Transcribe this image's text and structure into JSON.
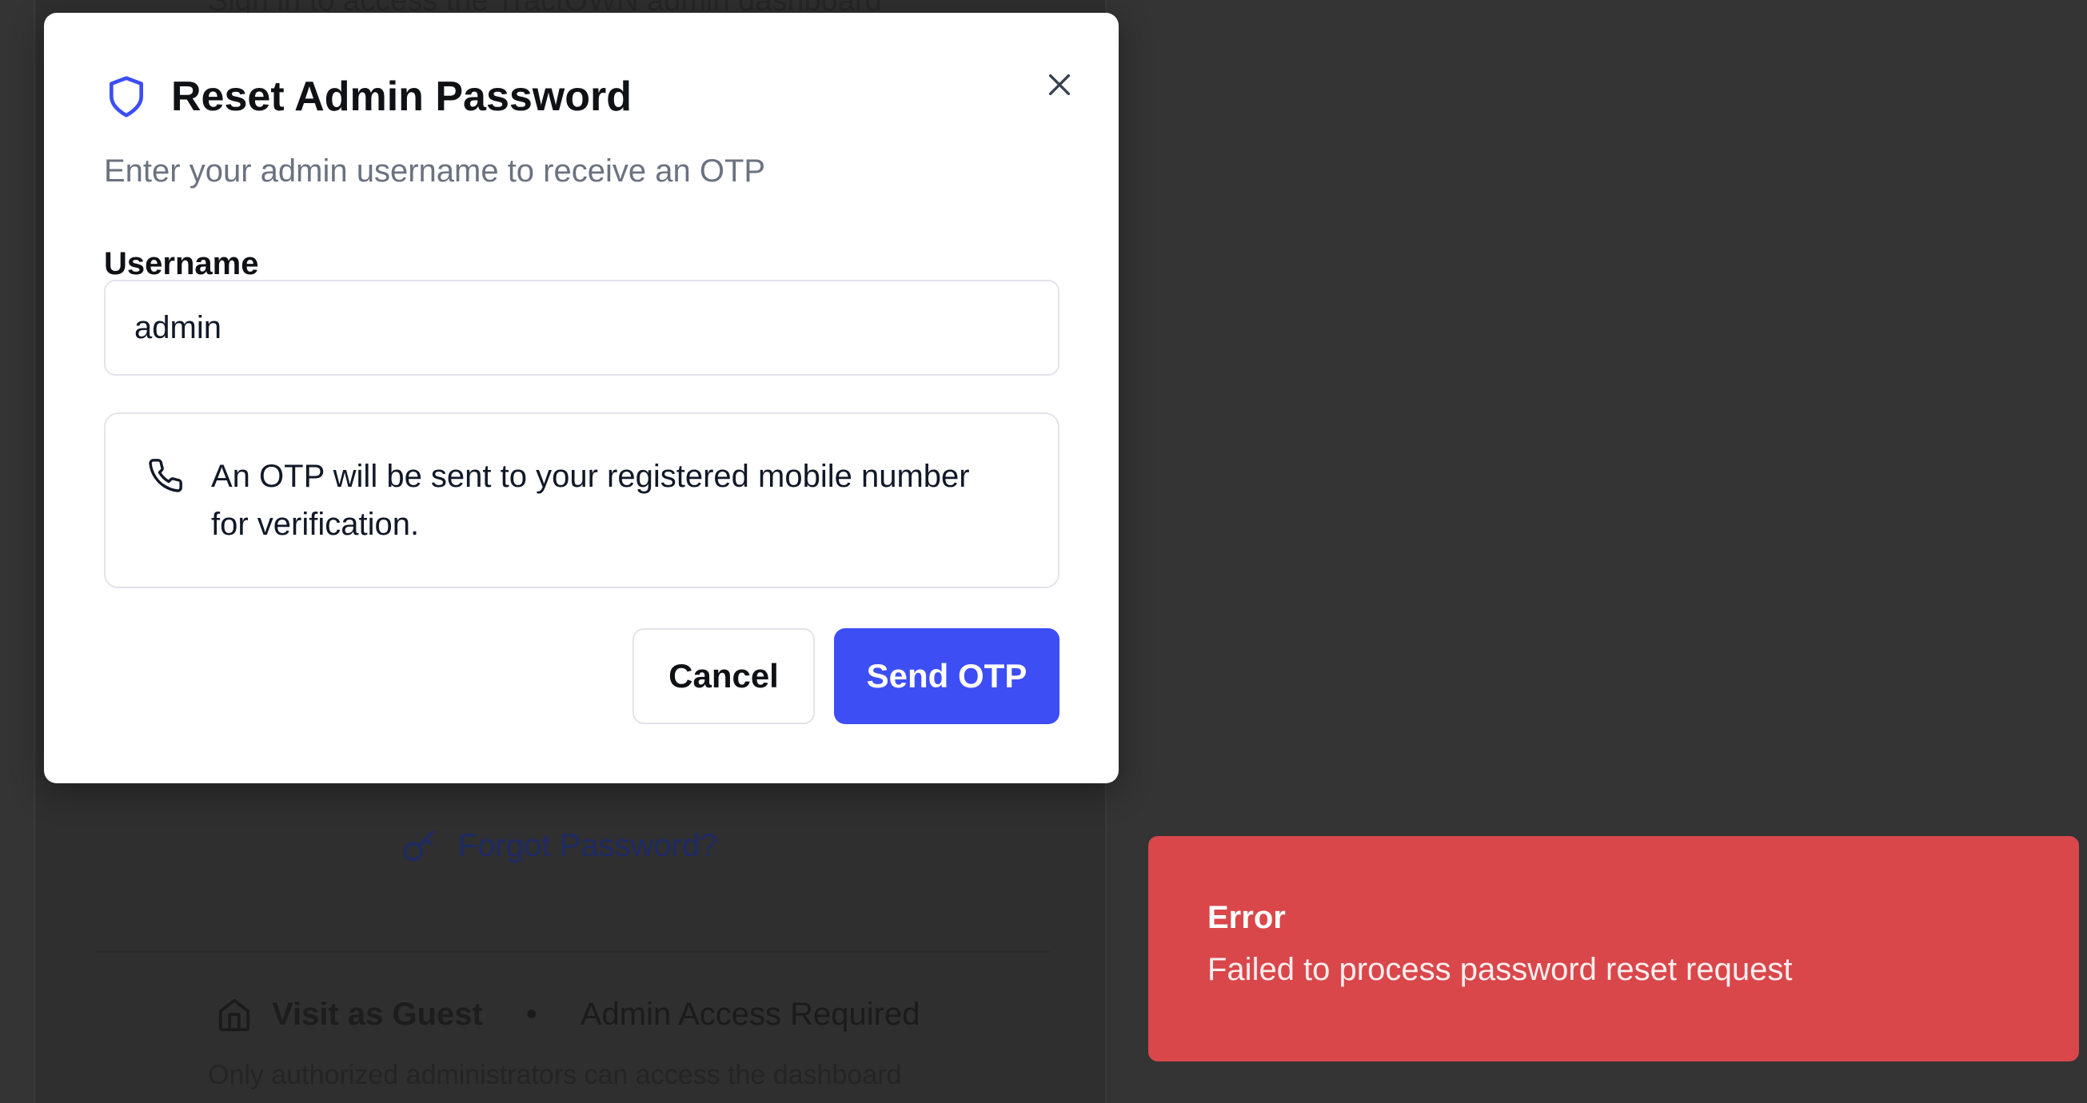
{
  "background": {
    "subtitle": "Sign in to access the TractOWN admin dashboard",
    "forgot_password_link": "Forgot Password?",
    "visit_guest_label": "Visit as Guest",
    "separator": "•",
    "admin_access_label": "Admin Access Required",
    "footnote": "Only authorized administrators can access the dashboard"
  },
  "modal": {
    "title": "Reset Admin Password",
    "subtitle": "Enter your admin username to receive an OTP",
    "username_label": "Username",
    "username_value": "admin",
    "info_text": "An OTP will be sent to your registered mobile number for verification.",
    "cancel_label": "Cancel",
    "send_label": "Send OTP",
    "icons": {
      "header": "shield-icon",
      "close": "close-icon",
      "info": "phone-icon"
    }
  },
  "toast": {
    "title": "Error",
    "message": "Failed to process password reset request"
  },
  "colors": {
    "accent": "#3d4ef5",
    "error": "#d9474b",
    "overlay": "#343434"
  }
}
